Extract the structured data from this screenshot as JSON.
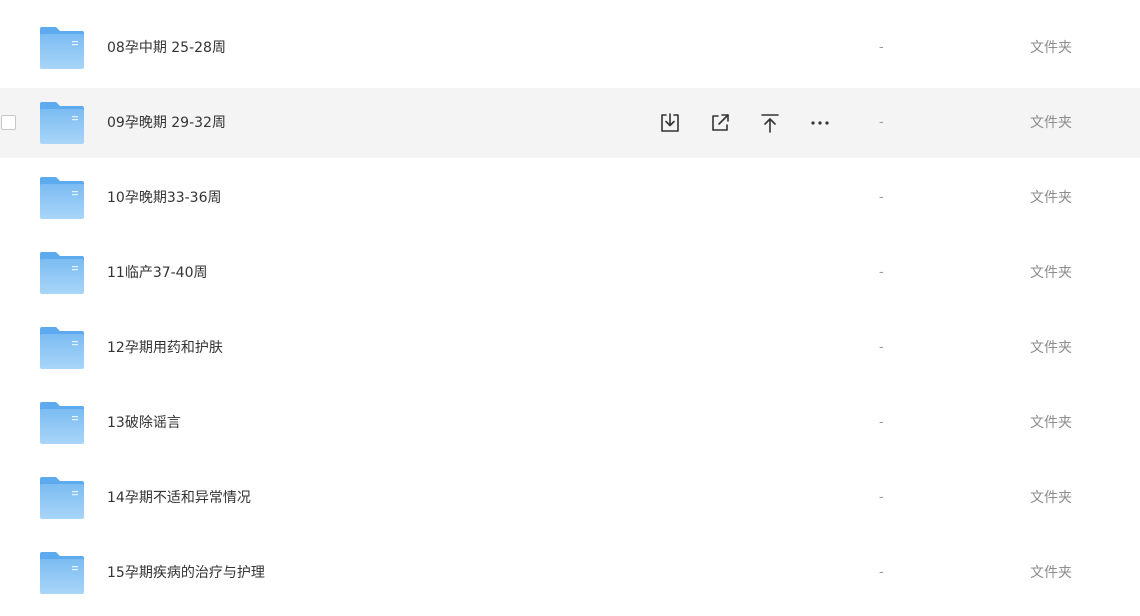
{
  "file_list": {
    "rows": [
      {
        "name": "08孕中期 25-28周",
        "size": "-",
        "type": "文件夹",
        "hovered": false
      },
      {
        "name": "09孕晚期 29-32周",
        "size": "-",
        "type": "文件夹",
        "hovered": true
      },
      {
        "name": "10孕晚期33-36周",
        "size": "-",
        "type": "文件夹",
        "hovered": false
      },
      {
        "name": "11临产37-40周",
        "size": "-",
        "type": "文件夹",
        "hovered": false
      },
      {
        "name": "12孕期用药和护肤",
        "size": "-",
        "type": "文件夹",
        "hovered": false
      },
      {
        "name": "13破除谣言",
        "size": "-",
        "type": "文件夹",
        "hovered": false
      },
      {
        "name": "14孕期不适和异常情况",
        "size": "-",
        "type": "文件夹",
        "hovered": false
      },
      {
        "name": "15孕期疾病的治疗与护理",
        "size": "-",
        "type": "文件夹",
        "hovered": false
      }
    ],
    "row_actions": [
      {
        "icon": "download-icon"
      },
      {
        "icon": "share-icon"
      },
      {
        "icon": "move-to-top-icon"
      },
      {
        "icon": "more-icon"
      }
    ]
  },
  "colors": {
    "folder_body": "#8cc7f5",
    "folder_back": "#5eaaee",
    "hover_row": "#f4f4f4"
  }
}
